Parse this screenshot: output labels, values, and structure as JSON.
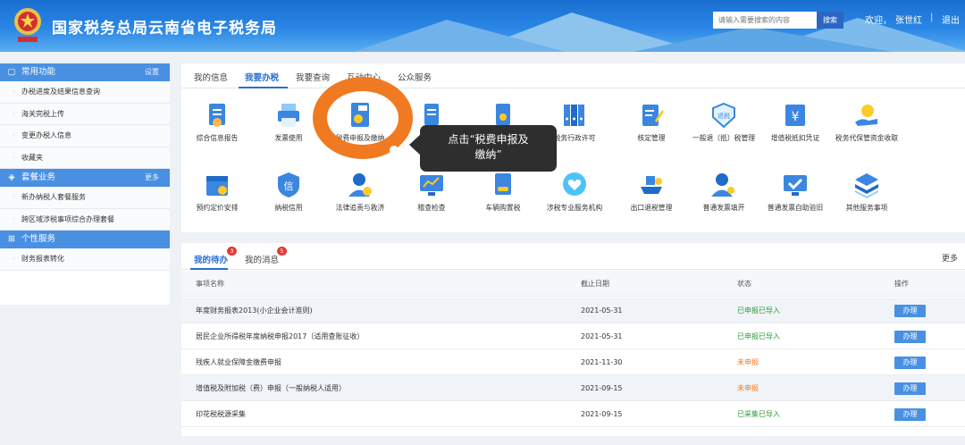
{
  "header": {
    "emblem": "tax-emblem-icon",
    "title": "国家税务总局云南省电子税务局",
    "search_placeholder": "请输入需要搜索的内容",
    "search_button": "搜索",
    "welcome": "欢迎，",
    "user_name": "张世红",
    "separator": "|",
    "logout": "退出",
    "colors": {
      "bar": "#2a86e6",
      "button": "#2a67c4"
    }
  },
  "sidebar": {
    "sections": [
      {
        "title": "常用功能",
        "icon": "grid-icon",
        "action": "设置",
        "items": [
          "办税进度及结果信息查询",
          "海关完税上传",
          "变更办税人信息",
          "收藏夹"
        ]
      },
      {
        "title": "套餐业务",
        "icon": "layers-icon",
        "action": "更多",
        "items": [
          "新办纳税人套餐服务",
          "跨区域涉税事项综合办理套餐"
        ]
      },
      {
        "title": "个性服务",
        "icon": "apps-icon",
        "action": "",
        "items": [
          "财务报表转化"
        ]
      }
    ]
  },
  "service_tabs": [
    "我的信息",
    "我要办税",
    "我要查询",
    "互动中心",
    "公众服务"
  ],
  "active_service_tab": "我要办税",
  "services_row1": [
    {
      "label": "综合信息报告",
      "icon": "report-icon"
    },
    {
      "label": "发票使用",
      "icon": "printer-icon"
    },
    {
      "label": "税费申报及缴纳",
      "icon": "tax-declare-icon"
    },
    {
      "label": "",
      "icon": "document-icon"
    },
    {
      "label": "",
      "icon": "certificate-icon"
    },
    {
      "label": "税务行政许可",
      "icon": "binders-icon"
    },
    {
      "label": "核定管理",
      "icon": "edit-doc-icon"
    },
    {
      "label": "一般退（抵）税管理",
      "icon": "refund-icon"
    },
    {
      "label": "增值税抵扣凭证",
      "icon": "yen-voucher-icon"
    },
    {
      "label": "税务代保管资金收取",
      "icon": "hand-money-icon"
    }
  ],
  "services_row2": [
    {
      "label": "预约定价安排",
      "icon": "calendar-icon"
    },
    {
      "label": "纳税信用",
      "icon": "credit-shield-icon"
    },
    {
      "label": "法律追责与救济",
      "icon": "law-person-icon"
    },
    {
      "label": "稽查检查",
      "icon": "monitor-chart-icon"
    },
    {
      "label": "车辆购置税",
      "icon": "vehicle-tax-icon"
    },
    {
      "label": "涉税专业服务机构",
      "icon": "heart-chat-icon"
    },
    {
      "label": "出口退税管理",
      "icon": "ship-icon"
    },
    {
      "label": "普通发票填开",
      "icon": "user-invoice-icon"
    },
    {
      "label": "普通发票自助验旧",
      "icon": "monitor-check-icon"
    },
    {
      "label": "其他服务事项",
      "icon": "stack-icon"
    }
  ],
  "annotation": {
    "callout_line1": "点击“税费申报及",
    "callout_line2": "缴纳”",
    "ring_color": "#f07a22"
  },
  "tasks": {
    "tabs": [
      {
        "label": "我的待办",
        "badge": "3"
      },
      {
        "label": "我的消息",
        "badge": "5"
      }
    ],
    "more": "更多",
    "columns": [
      "事项名称",
      "截止日期",
      "状态",
      "操作"
    ],
    "rows": [
      {
        "name": "年度财务报表2013(小企业会计准则)",
        "deadline": "2021-05-31",
        "status": "已申报已导入",
        "status_color": "#2e9a3c",
        "action": "办理"
      },
      {
        "name": "居民企业所得税年度纳税申报2017（适用查账征收）",
        "deadline": "2021-05-31",
        "status": "已申报已导入",
        "status_color": "#2e9a3c",
        "action": "办理"
      },
      {
        "name": "残疾人就业保障金缴费申报",
        "deadline": "2021-11-30",
        "status": "未申报",
        "status_color": "#f07a22",
        "action": "办理"
      },
      {
        "name": "增值税及附加税（费）申报（一般纳税人适用）",
        "deadline": "2021-09-15",
        "status": "未申报",
        "status_color": "#f07a22",
        "action": "办理"
      },
      {
        "name": "印花税税源采集",
        "deadline": "2021-09-15",
        "status": "已采集已导入",
        "status_color": "#2e9a3c",
        "action": "办理"
      }
    ]
  }
}
